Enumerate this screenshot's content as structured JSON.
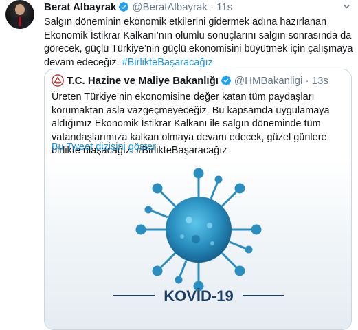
{
  "tweet": {
    "author_name": "Berat Albayrak",
    "author_handle": "@BeratAlbayrak",
    "separator": "·",
    "time": "11s",
    "text": "Salgın döneminin ekonomik etkilerini gidermek adına hazırlanan Ekonomik İstikrar Kalkanı’nın olumlu sonuçlarını salgın sonrasında da görecek, güçlü Türkiye’nin güçlü ekonomisini büyütmek için çalışmaya devam edeceğiz.",
    "hashtag": "#BirlikteBaşaracağız",
    "verified": true
  },
  "quoted_tweet": {
    "author_name": "T.C. Hazine ve Maliye Bakanlığı",
    "author_handle": "@HMBakanligi",
    "separator": "·",
    "time": "13s",
    "text": "Üreten Türkiye’nin ekonomisine değer katan tüm paydaşları korumaktan asla vazgeçmeyeceğiz. Bu kapsamda uygulamaya aldığımız Ekonomik İstikrar Kalkanı ile salgın döneminde tüm vatandaşlarımıza kalkan olmaya devam edecek, güzel günlere birlikte ulaşacağız.",
    "hashtag": "#BirlikteBaşaracağız",
    "show_thread_label": "Bu Tweet dizisini göster",
    "verified": true,
    "media_caption": "KOVİD-19"
  },
  "icons": {
    "verified": "verified-badge-icon",
    "more": "chevron-down-icon",
    "ministry_logo": "ministry-logo-icon"
  },
  "colors": {
    "link": "#1b95e0",
    "secondary_text": "#657786",
    "virus": "#2a8fc0",
    "caption": "#1d3f66"
  }
}
